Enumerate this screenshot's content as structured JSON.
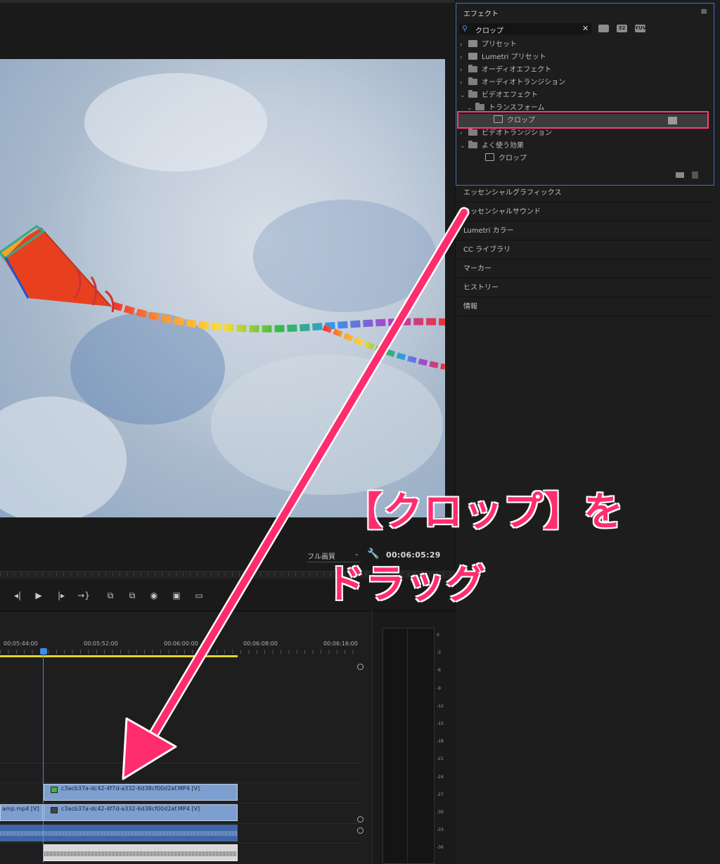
{
  "monitor": {
    "fit_label": "フル画質",
    "timecode": "00:06:05:29"
  },
  "transport": {
    "buttons": [
      {
        "icon": "step-back-icon",
        "glyph": "◂|"
      },
      {
        "icon": "play-icon",
        "glyph": "▶"
      },
      {
        "icon": "step-forward-icon",
        "glyph": "|▸"
      },
      {
        "icon": "go-to-out-icon",
        "glyph": "→}"
      },
      {
        "icon": "lift-icon",
        "glyph": "⧉"
      },
      {
        "icon": "extract-icon",
        "glyph": "⧉"
      },
      {
        "icon": "camera-icon",
        "glyph": "◉"
      },
      {
        "icon": "compare-icon",
        "glyph": "▣"
      },
      {
        "icon": "safe-margins-icon",
        "glyph": "▭"
      }
    ]
  },
  "effects": {
    "title": "エフェクト",
    "search_value": "クロップ",
    "filter_icons": [
      "accelerated-icon",
      "32bit-icon",
      "yuv-icon"
    ],
    "filter_labels": [
      "",
      "32",
      "YUV"
    ],
    "tree": [
      {
        "label": "プリセット",
        "arrow": "›",
        "icon": "preset-folder"
      },
      {
        "label": "Lumetri プリセット",
        "arrow": "›",
        "icon": "preset-folder"
      },
      {
        "label": "オーディオエフェクト",
        "arrow": "›",
        "icon": "folder"
      },
      {
        "label": "オーディオトランジション",
        "arrow": "›",
        "icon": "folder"
      },
      {
        "label": "ビデオエフェクト",
        "arrow": "⌄",
        "icon": "folder"
      },
      {
        "label": "トランスフォーム",
        "arrow": "⌄",
        "icon": "folder"
      },
      {
        "label": "クロップ",
        "arrow": "",
        "icon": "effect"
      },
      {
        "label": "ビデオトランジション",
        "arrow": "›",
        "icon": "folder"
      },
      {
        "label": "よく使う効果",
        "arrow": "⌄",
        "icon": "folder"
      },
      {
        "label": "クロップ",
        "arrow": "",
        "icon": "effect"
      }
    ]
  },
  "panels": [
    "エッセンシャルグラフィックス",
    "エッセンシャルサウンド",
    "Lumetri カラー",
    "CC ライブラリ",
    "マーカー",
    "ヒストリー",
    "情報"
  ],
  "timeline": {
    "ruler": [
      "00:05:44:00",
      "00:05:52:00",
      "00:06:00:00",
      "00:06:08:00",
      "00:06:16:00"
    ],
    "clips": {
      "v2": "c3acb37a-dc42-4f7d-a332-6d38cf00d2af.MP4 [V]",
      "v1_left": "amp.mp4 [V]",
      "v1": "c3acb37a-dc42-4f7d-a332-6d38cf00d2af.MP4 [V]"
    }
  },
  "meter": {
    "labels": [
      "0",
      "-3",
      "-6",
      "-9",
      "-12",
      "-15",
      "-18",
      "-21",
      "-24",
      "-27",
      "-30",
      "-33",
      "-36"
    ]
  },
  "annotation": {
    "line1": "【クロップ】を",
    "line2": "ドラッグ",
    "color": "#ff2d6e"
  },
  "colors": {
    "highlight": "#ff3b7b",
    "panel_focus": "#3d73c8",
    "playhead": "#3b8cf0",
    "work_area": "#e3d522",
    "clip": "#7d9fd0"
  }
}
